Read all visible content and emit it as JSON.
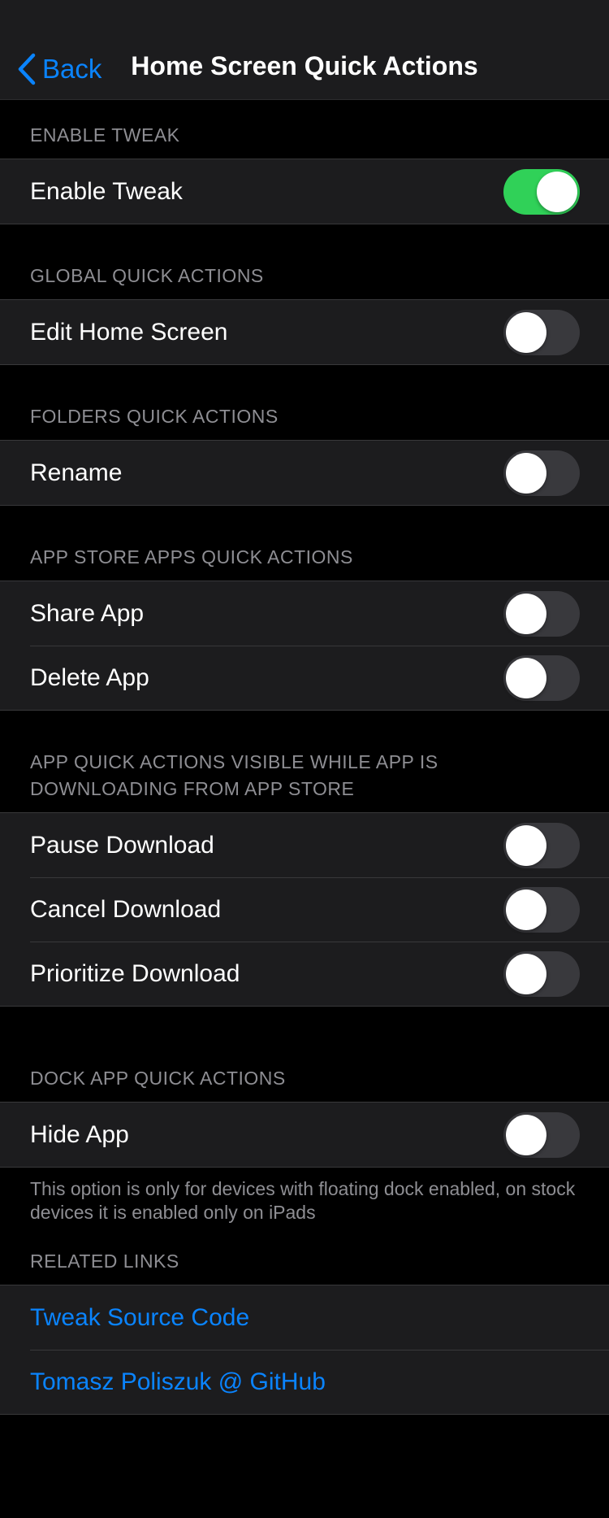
{
  "nav": {
    "back_label": "Back",
    "title": "Home Screen Quick Actions"
  },
  "colors": {
    "accent": "#0a84ff",
    "toggle_on": "#30d158",
    "toggle_off": "#39393d",
    "cell_bg": "#1c1c1e",
    "page_bg": "#000000"
  },
  "sections": {
    "enable": {
      "header": "ENABLE TWEAK",
      "rows": [
        {
          "label": "Enable Tweak",
          "on": true
        }
      ]
    },
    "global": {
      "header": "GLOBAL QUICK ACTIONS",
      "rows": [
        {
          "label": "Edit Home Screen",
          "on": false
        }
      ]
    },
    "folders": {
      "header": "FOLDERS QUICK ACTIONS",
      "rows": [
        {
          "label": "Rename",
          "on": false
        }
      ]
    },
    "appstore": {
      "header": "APP STORE APPS QUICK ACTIONS",
      "rows": [
        {
          "label": "Share App",
          "on": false
        },
        {
          "label": "Delete App",
          "on": false
        }
      ]
    },
    "downloading": {
      "header": "APP QUICK ACTIONS VISIBLE WHILE APP IS DOWNLOADING FROM APP STORE",
      "rows": [
        {
          "label": "Pause Download",
          "on": false
        },
        {
          "label": "Cancel Download",
          "on": false
        },
        {
          "label": "Prioritize Download",
          "on": false
        }
      ]
    },
    "dock": {
      "header": "DOCK APP QUICK ACTIONS",
      "rows": [
        {
          "label": "Hide App",
          "on": false
        }
      ],
      "footer": "This option is only for devices with floating dock enabled, on stock devices it is enabled only on iPads"
    },
    "links": {
      "header": "RELATED LINKS",
      "rows": [
        {
          "label": "Tweak Source Code"
        },
        {
          "label": "Tomasz Poliszuk @ GitHub"
        }
      ]
    }
  }
}
